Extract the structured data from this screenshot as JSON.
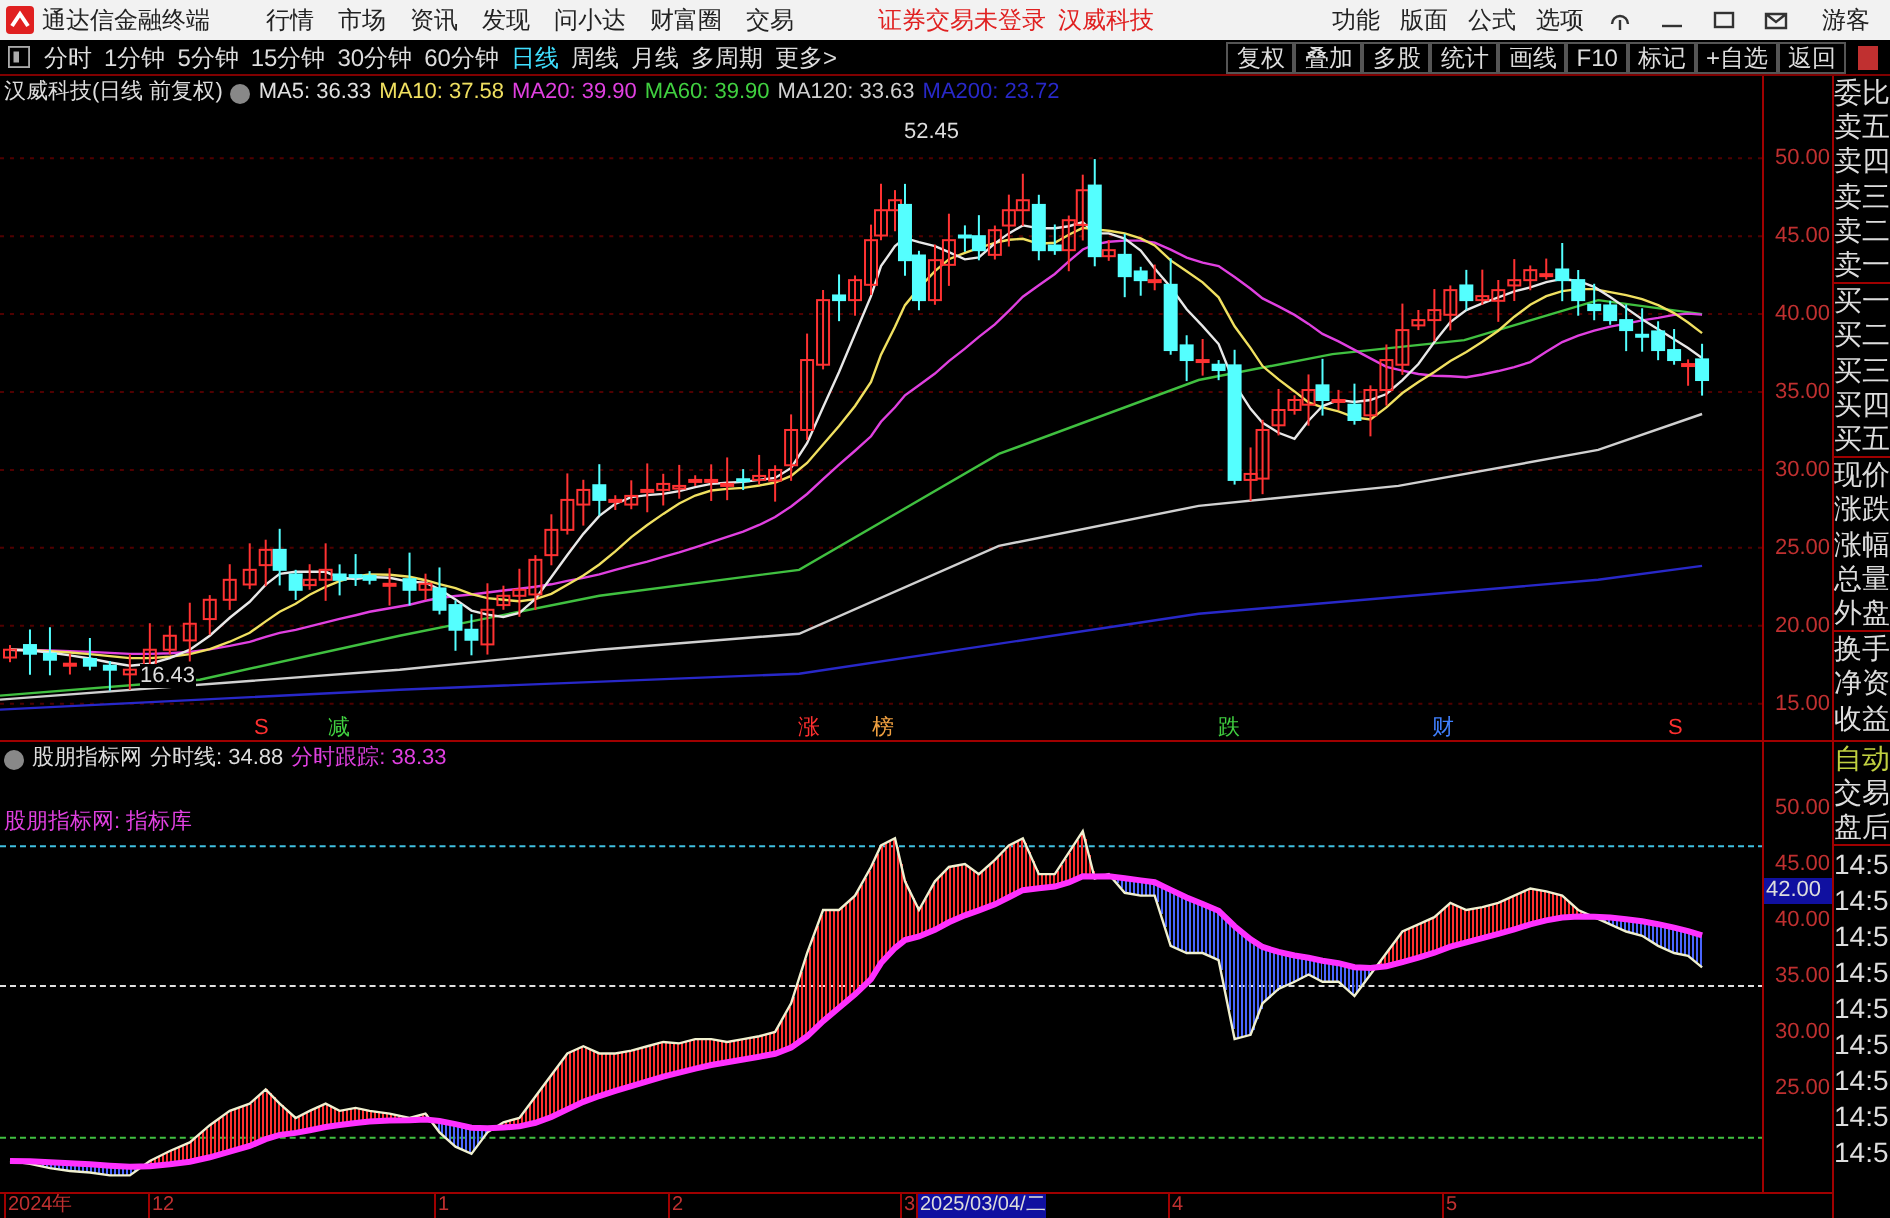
{
  "app": {
    "title": "通达信金融终端"
  },
  "menu": [
    "行情",
    "市场",
    "资讯",
    "发现",
    "问小达",
    "财富圈",
    "交易"
  ],
  "login_status": "证券交易未登录",
  "stock_name": "汉威科技",
  "top_right_menu": [
    "功能",
    "版面",
    "公式",
    "选项"
  ],
  "user": "游客",
  "periods": [
    {
      "label": "分时",
      "selected": false
    },
    {
      "label": "1分钟",
      "selected": false
    },
    {
      "label": "5分钟",
      "selected": false
    },
    {
      "label": "15分钟",
      "selected": false
    },
    {
      "label": "30分钟",
      "selected": false
    },
    {
      "label": "60分钟",
      "selected": false
    },
    {
      "label": "日线",
      "selected": true
    },
    {
      "label": "周线",
      "selected": false
    },
    {
      "label": "月线",
      "selected": false
    },
    {
      "label": "多周期",
      "selected": false
    },
    {
      "label": "更多>",
      "selected": false
    }
  ],
  "toolbar_buttons": [
    "复权",
    "叠加",
    "多股",
    "统计",
    "画线",
    "F10",
    "标记",
    "+自选",
    "返回"
  ],
  "main_chart": {
    "title": "汉威科技(日线 前复权)",
    "ma_legend": [
      {
        "label": "MA5: 36.33",
        "color": "#e0e0e0"
      },
      {
        "label": "MA10: 37.58",
        "color": "#f0e060"
      },
      {
        "label": "MA20: 39.90",
        "color": "#e040e0"
      },
      {
        "label": "MA60: 39.90",
        "color": "#40d040"
      },
      {
        "label": "MA120: 33.63",
        "color": "#d0d0d0"
      },
      {
        "label": "MA200: 23.72",
        "color": "#2828c8"
      }
    ],
    "high_label": "52.45",
    "low_label": "16.43",
    "y_axis": [
      "50.00",
      "45.00",
      "40.00",
      "35.00",
      "30.00",
      "25.00",
      "20.00",
      "15.00"
    ],
    "signals": [
      {
        "text": "S",
        "color": "#ff3030"
      },
      {
        "text": "减",
        "color": "#40d040"
      },
      {
        "text": "涨",
        "color": "#ff3030"
      },
      {
        "text": "榜",
        "color": "#f0a040"
      },
      {
        "text": "跌",
        "color": "#40d040"
      },
      {
        "text": "财",
        "color": "#4080ff"
      },
      {
        "text": "S",
        "color": "#ff3030"
      }
    ]
  },
  "indicator": {
    "name": "股朋指标网",
    "line_label": "分时线: 34.88",
    "track_label": "分时跟踪: 38.33",
    "note": "股朋指标网: 指标库",
    "y_axis": [
      "50.00",
      "45.00",
      "40.00",
      "35.00",
      "30.00",
      "25.00"
    ],
    "cursor_value": "42.00"
  },
  "date_axis": [
    {
      "label": "2024年",
      "selected": false
    },
    {
      "label": "12",
      "selected": false
    },
    {
      "label": "1",
      "selected": false
    },
    {
      "label": "2",
      "selected": false
    },
    {
      "label": "3",
      "selected": false
    },
    {
      "label": "2025/03/04/二",
      "selected": true
    },
    {
      "label": "4",
      "selected": false
    },
    {
      "label": "5",
      "selected": false
    }
  ],
  "quote_panel": {
    "labels": [
      "委比",
      "卖五",
      "卖四",
      "卖三",
      "卖二",
      "卖一",
      "买一",
      "买二",
      "买三",
      "买四",
      "买五",
      "现价",
      "涨跌",
      "涨幅",
      "总量",
      "外盘",
      "换手",
      "净资",
      "收益"
    ],
    "mode": "自动",
    "items": [
      "交易",
      "盘后"
    ],
    "times": [
      "14:5",
      "14:5",
      "14:5",
      "14:5",
      "14:5",
      "14:5",
      "14:5",
      "14:5",
      "14:5"
    ]
  }
}
